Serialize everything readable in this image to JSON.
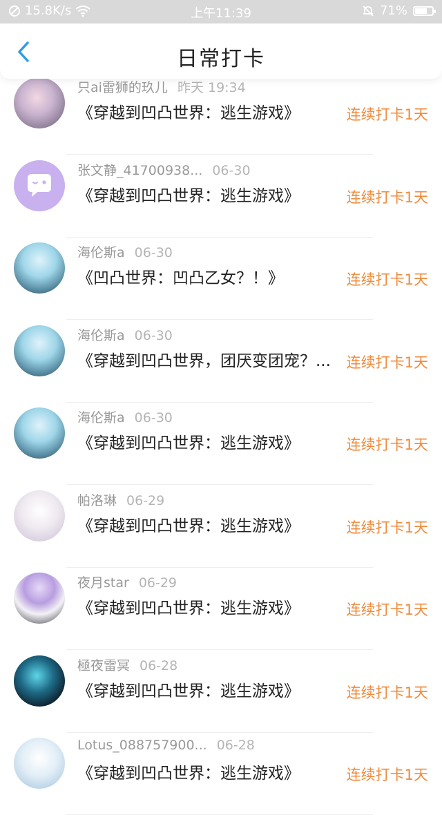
{
  "status_bar": {
    "net_speed": "15.8K/s",
    "time": "上午11:39",
    "battery": "71%",
    "battery_level": 0.71
  },
  "header": {
    "title": "日常打卡"
  },
  "entries": [
    {
      "user": "只ai雷狮的玖儿",
      "date": "昨天 19:34",
      "book": "《穿越到凹凸世界：逃生游戏》",
      "streak": "连续打卡1天"
    },
    {
      "user": "张文静_41700938...",
      "date": "06-30",
      "book": "《穿越到凹凸世界：逃生游戏》",
      "streak": "连续打卡1天"
    },
    {
      "user": "海伦斯a",
      "date": "06-30",
      "book": "《凹凸世界：凹凸乙女？！》",
      "streak": "连续打卡1天"
    },
    {
      "user": "海伦斯a",
      "date": "06-30",
      "book": "《穿越到凹凸世界，团厌变团宠？...",
      "streak": "连续打卡1天"
    },
    {
      "user": "海伦斯a",
      "date": "06-30",
      "book": "《穿越到凹凸世界：逃生游戏》",
      "streak": "连续打卡1天"
    },
    {
      "user": "帕洛琳",
      "date": "06-29",
      "book": "《穿越到凹凸世界：逃生游戏》",
      "streak": "连续打卡1天"
    },
    {
      "user": "夜月star",
      "date": "06-29",
      "book": "《穿越到凹凸世界：逃生游戏》",
      "streak": "连续打卡1天"
    },
    {
      "user": "極夜雷冥",
      "date": "06-28",
      "book": "《穿越到凹凸世界：逃生游戏》",
      "streak": "连续打卡1天"
    },
    {
      "user": "Lotus_088757900...",
      "date": "06-28",
      "book": "《穿越到凹凸世界：逃生游戏》",
      "streak": "连续打卡1天"
    }
  ],
  "colors": {
    "accent": "#f08a3a",
    "back_arrow": "#2f9be6",
    "status_bar_bg": "#d9d9d9"
  }
}
